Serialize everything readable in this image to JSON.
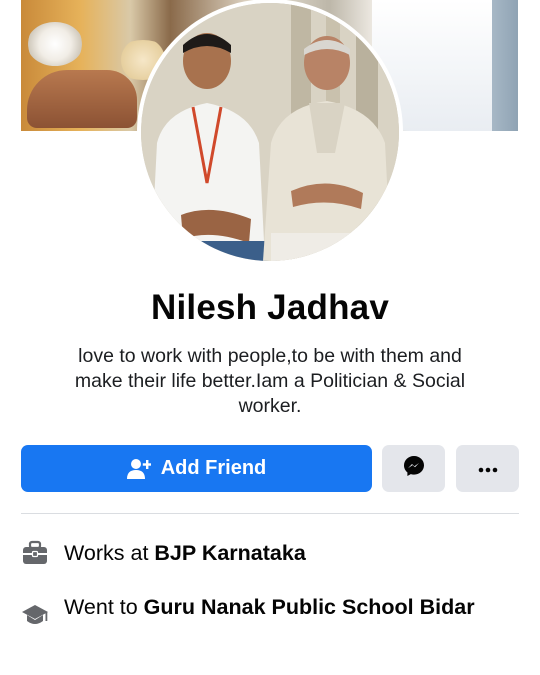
{
  "profile": {
    "name": "Nilesh Jadhav",
    "bio": "love to work with people,to be with them and make their life better.Iam a Politician & Social worker."
  },
  "actions": {
    "add_friend_label": "Add Friend",
    "add_friend_icon": "add-person-icon",
    "message_icon": "messenger-icon",
    "more_icon": "more-dots-icon"
  },
  "intro": {
    "work_prefix": "Works at ",
    "work_place": "BJP Karnataka",
    "work_icon": "briefcase-icon",
    "edu_prefix": "Went to ",
    "edu_place": "Guru Nanak Public School Bidar",
    "edu_icon": "graduation-cap-icon"
  },
  "colors": {
    "primary": "#1877f2",
    "secondary_button": "#e4e6eb",
    "icon_gray": "#65676b"
  }
}
